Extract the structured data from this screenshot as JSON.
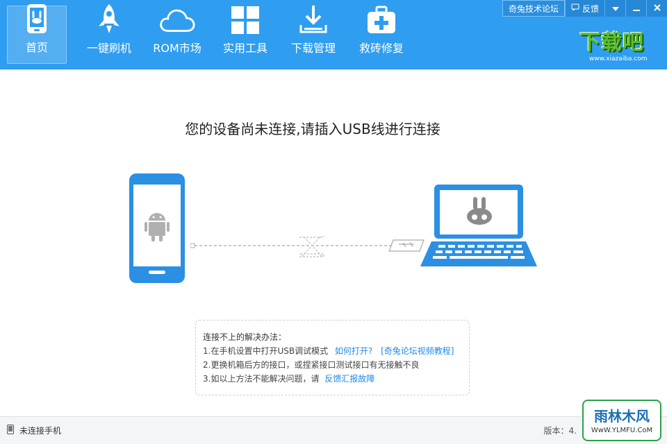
{
  "nav": [
    {
      "label": "首页",
      "icon": "phone-rabbit-icon",
      "active": true
    },
    {
      "label": "一键刷机",
      "icon": "rocket-icon"
    },
    {
      "label": "ROM市场",
      "icon": "cloud-icon"
    },
    {
      "label": "实用工具",
      "icon": "grid-icon"
    },
    {
      "label": "下载管理",
      "icon": "download-icon"
    },
    {
      "label": "救砖修复",
      "icon": "medical-kit-icon"
    }
  ],
  "topbar": {
    "forum": "奇兔技术论坛",
    "feedback": "反馈"
  },
  "logo": {
    "main": "下载吧",
    "sub": "www.xiazaiba.com"
  },
  "main": {
    "title": "您的设备尚未连接,请插入USB线进行连接"
  },
  "help": {
    "title": "连接不上的解决办法：",
    "line1": "1.在手机设置中打开USB调试模式",
    "line1_link1": "如何打开?",
    "line1_link2": "[奇兔论坛视频教程]",
    "line2": "2.更换机箱后方的接口，或捏紧接口测试接口有无接触不良",
    "line3": "3.如以上方法不能解决问题，请",
    "line3_link": "反馈汇报故障"
  },
  "status": {
    "left": "未连接手机",
    "version": "版本：4."
  },
  "watermark": {
    "main": "雨林木风",
    "sub": "WwW.YLMFU.CoM"
  },
  "colors": {
    "header": "#2f9df0",
    "device_blue": "#2b8fe3",
    "link": "#1e88e5"
  }
}
